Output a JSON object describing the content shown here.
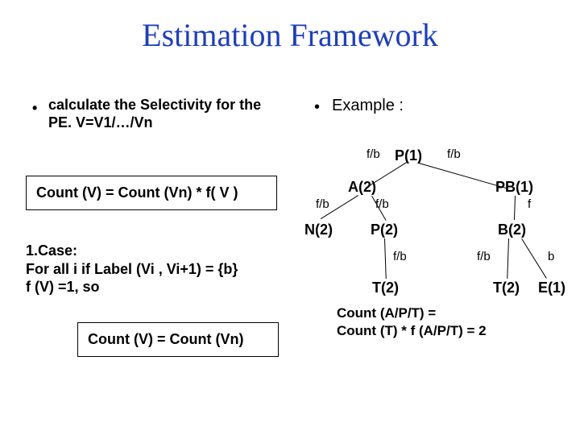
{
  "title": "Estimation Framework",
  "left": {
    "bullet": "calculate the Selectivity for the PE. V=V1/…/Vn",
    "formula1": "Count (V) = Count (Vn) * f( V )",
    "case": "1.Case:\nFor all i   if  Label (Vi , Vi+1) = {b}\nf (V) =1, so",
    "formula2": "Count (V) = Count (Vn)"
  },
  "right": {
    "bullet": "Example :",
    "nodes": {
      "P1": "P(1)",
      "A2": "A(2)",
      "PB1": "PB(1)",
      "N2": "N(2)",
      "P2": "P(2)",
      "B2": "B(2)",
      "T2a": "T(2)",
      "T2b": "T(2)",
      "E1": "E(1)"
    },
    "edges": {
      "fb": "f/b",
      "f": "f",
      "b": "b"
    },
    "result1": "Count (A/P/T) =",
    "result2": " Count (T) * f (A/P/T) = 2"
  }
}
